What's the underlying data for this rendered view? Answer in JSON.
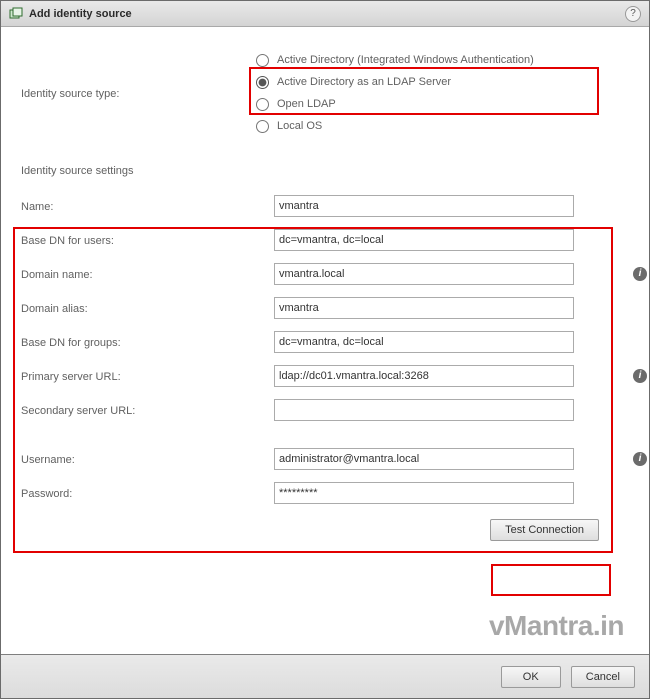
{
  "title": "Add identity source",
  "labels": {
    "source_type": "Identity source type:",
    "settings": "Identity source settings"
  },
  "radios": {
    "ad_windows": "Active Directory (Integrated Windows Authentication)",
    "ad_ldap": "Active Directory as an LDAP Server",
    "open_ldap": "Open LDAP",
    "local_os": "Local OS"
  },
  "fields": {
    "name": {
      "label": "Name:",
      "value": "vmantra"
    },
    "base_dn_users": {
      "label": "Base DN for users:",
      "value": "dc=vmantra, dc=local"
    },
    "domain_name": {
      "label": "Domain name:",
      "value": "vmantra.local"
    },
    "domain_alias": {
      "label": "Domain alias:",
      "value": "vmantra"
    },
    "base_dn_groups": {
      "label": "Base DN for groups:",
      "value": "dc=vmantra, dc=local"
    },
    "primary_url": {
      "label": "Primary server URL:",
      "value": "ldap://dc01.vmantra.local:3268"
    },
    "secondary_url": {
      "label": "Secondary server URL:",
      "value": ""
    },
    "username": {
      "label": "Username:",
      "value": "administrator@vmantra.local"
    },
    "password": {
      "label": "Password:",
      "value": "*********"
    }
  },
  "buttons": {
    "test": "Test Connection",
    "ok": "OK",
    "cancel": "Cancel"
  },
  "watermark": "vMantra.in",
  "help_icon": "?"
}
